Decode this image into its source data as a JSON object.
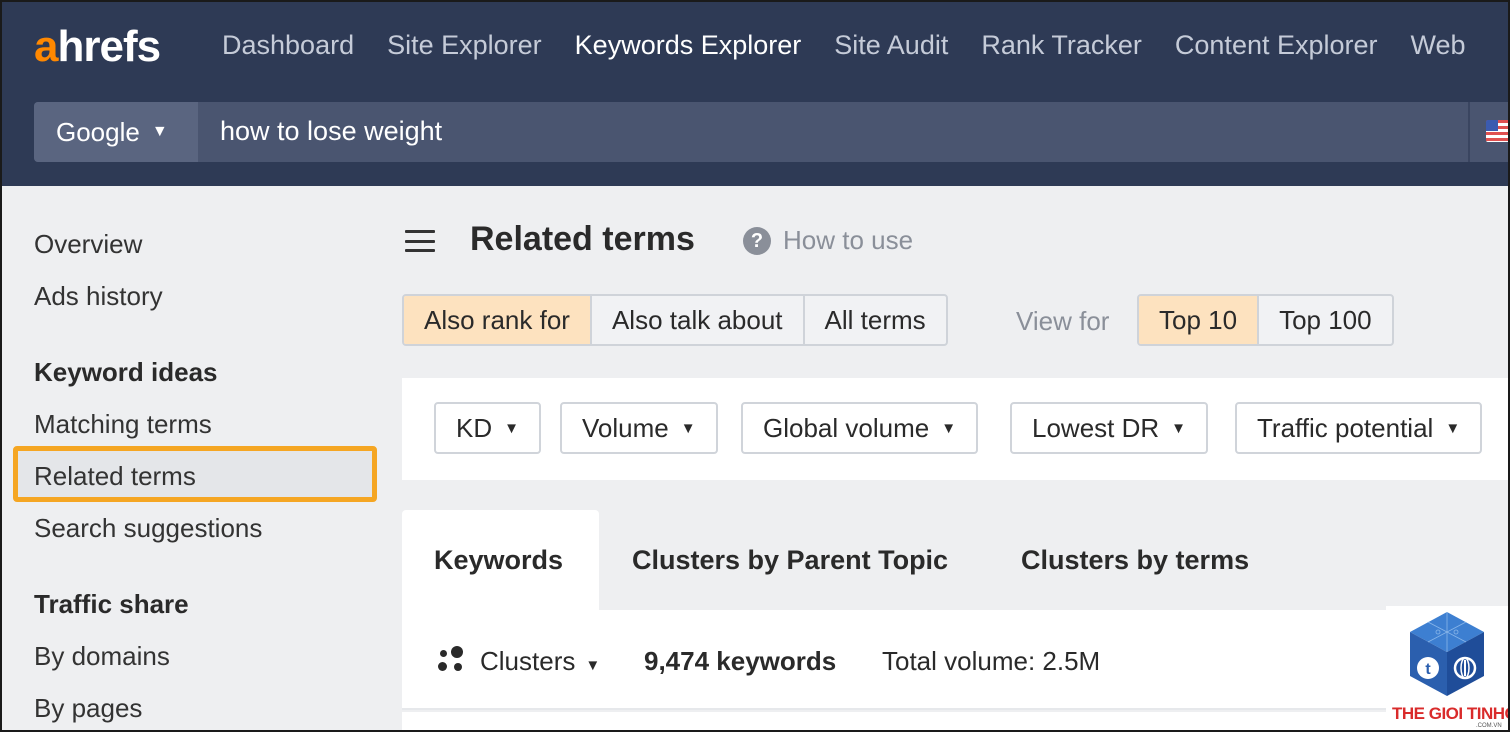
{
  "header": {
    "logo": {
      "accent": "a",
      "rest": "hrefs"
    },
    "nav": [
      {
        "label": "Dashboard",
        "active": false
      },
      {
        "label": "Site Explorer",
        "active": false
      },
      {
        "label": "Keywords Explorer",
        "active": true
      },
      {
        "label": "Site Audit",
        "active": false
      },
      {
        "label": "Rank Tracker",
        "active": false
      },
      {
        "label": "Content Explorer",
        "active": false
      },
      {
        "label": "Web",
        "active": false
      }
    ],
    "search": {
      "engine": "Google",
      "query": "how to lose weight"
    }
  },
  "sidebar": {
    "overview": "Overview",
    "ads_history": "Ads history",
    "keyword_ideas_heading": "Keyword ideas",
    "matching_terms": "Matching terms",
    "related_terms": "Related terms",
    "search_suggestions": "Search suggestions",
    "traffic_share_heading": "Traffic share",
    "by_domains": "By domains",
    "by_pages": "By pages"
  },
  "main": {
    "title": "Related terms",
    "help_symbol": "?",
    "how_to_use": "How to use",
    "mode_options": [
      "Also rank for",
      "Also talk about",
      "All terms"
    ],
    "mode_selected": "Also rank for",
    "view_for_label": "View for",
    "view_options": [
      "Top 10",
      "Top 100"
    ],
    "view_selected": "Top 10",
    "filters": [
      "KD",
      "Volume",
      "Global volume",
      "Lowest DR",
      "Traffic potential"
    ],
    "tabs": [
      "Keywords",
      "Clusters by Parent Topic",
      "Clusters by terms"
    ],
    "active_tab": "Keywords",
    "clusters_label": "Clusters",
    "keyword_count": "9,474 keywords",
    "total_volume": "Total volume: 2.5M"
  },
  "watermark": {
    "text": "THE GIOI TINHOC",
    "sub": ".COM.VN"
  },
  "colors": {
    "header_bg": "#2e3a55",
    "logo_accent": "#ff8800",
    "selected_segment": "#fde2bf",
    "highlight_border": "#f5a623",
    "watermark_red": "#d92b2b"
  },
  "icons": [
    "menu-icon",
    "help-icon",
    "chevron-down-icon",
    "clusters-icon",
    "us-flag-icon"
  ]
}
